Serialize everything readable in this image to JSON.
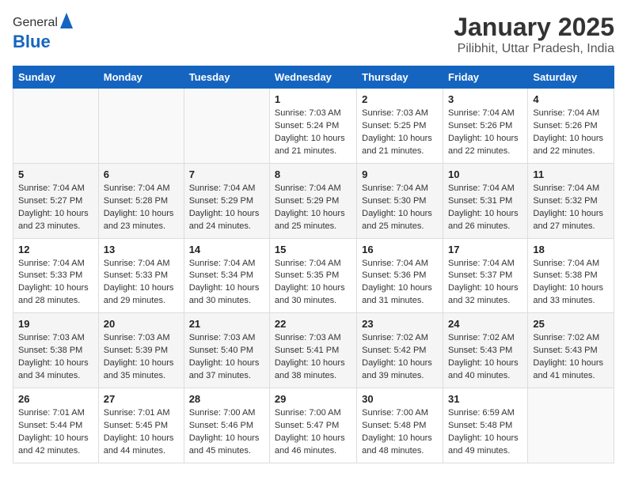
{
  "logo": {
    "general": "General",
    "blue": "Blue"
  },
  "header": {
    "month": "January 2025",
    "location": "Pilibhit, Uttar Pradesh, India"
  },
  "weekdays": [
    "Sunday",
    "Monday",
    "Tuesday",
    "Wednesday",
    "Thursday",
    "Friday",
    "Saturday"
  ],
  "weeks": [
    [
      {
        "day": "",
        "info": ""
      },
      {
        "day": "",
        "info": ""
      },
      {
        "day": "",
        "info": ""
      },
      {
        "day": "1",
        "info": "Sunrise: 7:03 AM\nSunset: 5:24 PM\nDaylight: 10 hours\nand 21 minutes."
      },
      {
        "day": "2",
        "info": "Sunrise: 7:03 AM\nSunset: 5:25 PM\nDaylight: 10 hours\nand 21 minutes."
      },
      {
        "day": "3",
        "info": "Sunrise: 7:04 AM\nSunset: 5:26 PM\nDaylight: 10 hours\nand 22 minutes."
      },
      {
        "day": "4",
        "info": "Sunrise: 7:04 AM\nSunset: 5:26 PM\nDaylight: 10 hours\nand 22 minutes."
      }
    ],
    [
      {
        "day": "5",
        "info": "Sunrise: 7:04 AM\nSunset: 5:27 PM\nDaylight: 10 hours\nand 23 minutes."
      },
      {
        "day": "6",
        "info": "Sunrise: 7:04 AM\nSunset: 5:28 PM\nDaylight: 10 hours\nand 23 minutes."
      },
      {
        "day": "7",
        "info": "Sunrise: 7:04 AM\nSunset: 5:29 PM\nDaylight: 10 hours\nand 24 minutes."
      },
      {
        "day": "8",
        "info": "Sunrise: 7:04 AM\nSunset: 5:29 PM\nDaylight: 10 hours\nand 25 minutes."
      },
      {
        "day": "9",
        "info": "Sunrise: 7:04 AM\nSunset: 5:30 PM\nDaylight: 10 hours\nand 25 minutes."
      },
      {
        "day": "10",
        "info": "Sunrise: 7:04 AM\nSunset: 5:31 PM\nDaylight: 10 hours\nand 26 minutes."
      },
      {
        "day": "11",
        "info": "Sunrise: 7:04 AM\nSunset: 5:32 PM\nDaylight: 10 hours\nand 27 minutes."
      }
    ],
    [
      {
        "day": "12",
        "info": "Sunrise: 7:04 AM\nSunset: 5:33 PM\nDaylight: 10 hours\nand 28 minutes."
      },
      {
        "day": "13",
        "info": "Sunrise: 7:04 AM\nSunset: 5:33 PM\nDaylight: 10 hours\nand 29 minutes."
      },
      {
        "day": "14",
        "info": "Sunrise: 7:04 AM\nSunset: 5:34 PM\nDaylight: 10 hours\nand 30 minutes."
      },
      {
        "day": "15",
        "info": "Sunrise: 7:04 AM\nSunset: 5:35 PM\nDaylight: 10 hours\nand 30 minutes."
      },
      {
        "day": "16",
        "info": "Sunrise: 7:04 AM\nSunset: 5:36 PM\nDaylight: 10 hours\nand 31 minutes."
      },
      {
        "day": "17",
        "info": "Sunrise: 7:04 AM\nSunset: 5:37 PM\nDaylight: 10 hours\nand 32 minutes."
      },
      {
        "day": "18",
        "info": "Sunrise: 7:04 AM\nSunset: 5:38 PM\nDaylight: 10 hours\nand 33 minutes."
      }
    ],
    [
      {
        "day": "19",
        "info": "Sunrise: 7:03 AM\nSunset: 5:38 PM\nDaylight: 10 hours\nand 34 minutes."
      },
      {
        "day": "20",
        "info": "Sunrise: 7:03 AM\nSunset: 5:39 PM\nDaylight: 10 hours\nand 35 minutes."
      },
      {
        "day": "21",
        "info": "Sunrise: 7:03 AM\nSunset: 5:40 PM\nDaylight: 10 hours\nand 37 minutes."
      },
      {
        "day": "22",
        "info": "Sunrise: 7:03 AM\nSunset: 5:41 PM\nDaylight: 10 hours\nand 38 minutes."
      },
      {
        "day": "23",
        "info": "Sunrise: 7:02 AM\nSunset: 5:42 PM\nDaylight: 10 hours\nand 39 minutes."
      },
      {
        "day": "24",
        "info": "Sunrise: 7:02 AM\nSunset: 5:43 PM\nDaylight: 10 hours\nand 40 minutes."
      },
      {
        "day": "25",
        "info": "Sunrise: 7:02 AM\nSunset: 5:43 PM\nDaylight: 10 hours\nand 41 minutes."
      }
    ],
    [
      {
        "day": "26",
        "info": "Sunrise: 7:01 AM\nSunset: 5:44 PM\nDaylight: 10 hours\nand 42 minutes."
      },
      {
        "day": "27",
        "info": "Sunrise: 7:01 AM\nSunset: 5:45 PM\nDaylight: 10 hours\nand 44 minutes."
      },
      {
        "day": "28",
        "info": "Sunrise: 7:00 AM\nSunset: 5:46 PM\nDaylight: 10 hours\nand 45 minutes."
      },
      {
        "day": "29",
        "info": "Sunrise: 7:00 AM\nSunset: 5:47 PM\nDaylight: 10 hours\nand 46 minutes."
      },
      {
        "day": "30",
        "info": "Sunrise: 7:00 AM\nSunset: 5:48 PM\nDaylight: 10 hours\nand 48 minutes."
      },
      {
        "day": "31",
        "info": "Sunrise: 6:59 AM\nSunset: 5:48 PM\nDaylight: 10 hours\nand 49 minutes."
      },
      {
        "day": "",
        "info": ""
      }
    ]
  ]
}
